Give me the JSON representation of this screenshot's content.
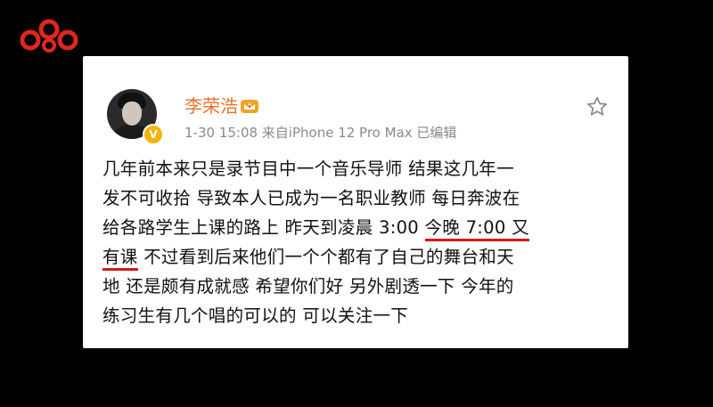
{
  "watermark": {
    "icon": "chain-logo-icon",
    "color": "#e1261c"
  },
  "post": {
    "username": "李荣浩",
    "badge_icon": "crown-badge-icon",
    "verified_icon": "verified-v-icon",
    "meta": "1-30 15:08  来自iPhone 12 Pro Max  已编辑",
    "favorite_icon": "star-icon",
    "lines": [
      "几年前本来只是录节目中一个音乐导师 结果这几年一",
      "发不可收拾 导致本人已成为一名职业教师 每日奔波在",
      "给各路学生上课的路上 昨天到凌晨 3:00 ",
      "今晚 7:00 又",
      "有课",
      " 不过看到后来他们一个个都有了自己的舞台和天",
      "地 还是颇有成就感 希望你们好 另外剧透一下 今年的",
      "练习生有几个唱的可以的 可以关注一下"
    ]
  },
  "colors": {
    "username": "#e8722c",
    "highlight_underline": "#d31a1a"
  }
}
